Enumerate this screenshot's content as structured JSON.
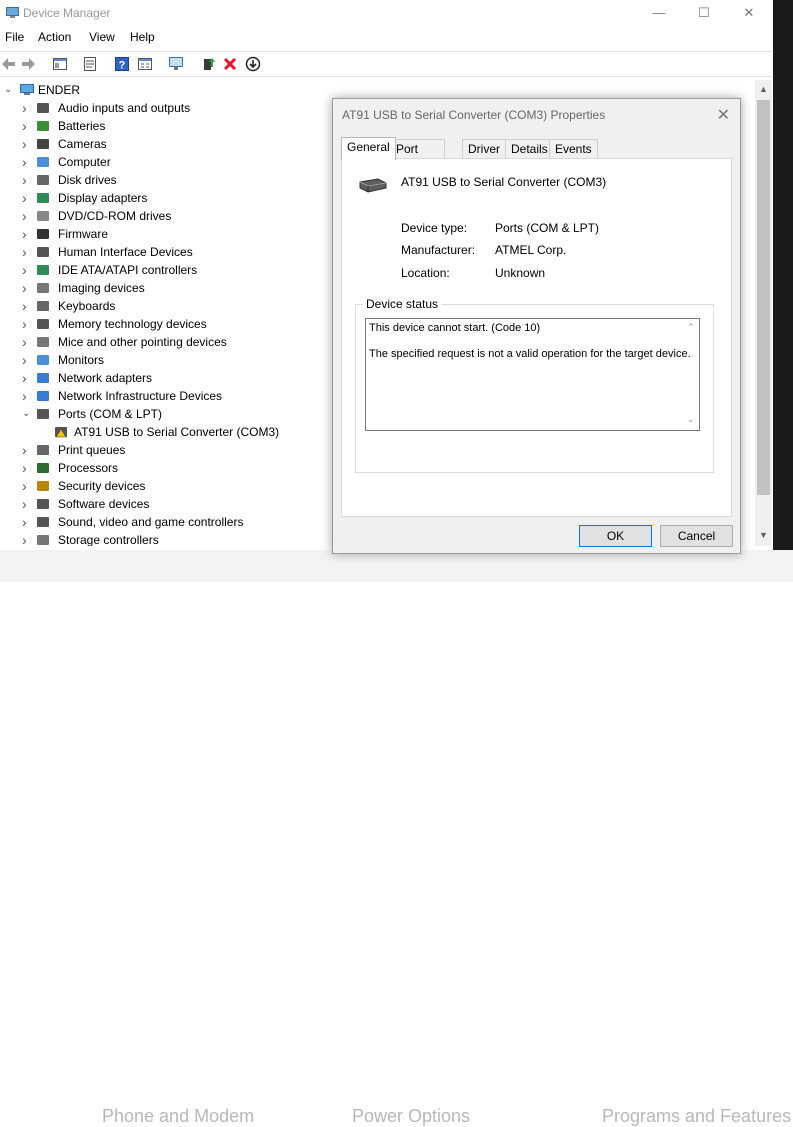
{
  "device_manager": {
    "title": "Device Manager",
    "menu": [
      "File",
      "Action",
      "View",
      "Help"
    ],
    "tree": {
      "root": "ENDER",
      "items": [
        {
          "label": "Audio inputs and outputs",
          "icon": "speaker-icon"
        },
        {
          "label": "Batteries",
          "icon": "battery-icon"
        },
        {
          "label": "Cameras",
          "icon": "camera-icon"
        },
        {
          "label": "Computer",
          "icon": "computer-icon"
        },
        {
          "label": "Disk drives",
          "icon": "disk-icon"
        },
        {
          "label": "Display adapters",
          "icon": "display-adapter-icon"
        },
        {
          "label": "DVD/CD-ROM drives",
          "icon": "dvd-icon"
        },
        {
          "label": "Firmware",
          "icon": "firmware-icon"
        },
        {
          "label": "Human Interface Devices",
          "icon": "hid-icon"
        },
        {
          "label": "IDE ATA/ATAPI controllers",
          "icon": "ide-icon"
        },
        {
          "label": "Imaging devices",
          "icon": "imaging-icon"
        },
        {
          "label": "Keyboards",
          "icon": "keyboard-icon"
        },
        {
          "label": "Memory technology devices",
          "icon": "memory-icon"
        },
        {
          "label": "Mice and other pointing devices",
          "icon": "mouse-icon"
        },
        {
          "label": "Monitors",
          "icon": "monitor-icon"
        },
        {
          "label": "Network adapters",
          "icon": "network-icon"
        },
        {
          "label": "Network Infrastructure Devices",
          "icon": "network-infra-icon"
        },
        {
          "label": "Ports (COM & LPT)",
          "icon": "port-icon",
          "expanded": true
        },
        {
          "label": "AT91 USB to Serial Converter (COM3)",
          "icon": "warning-port-icon",
          "child": true
        },
        {
          "label": "Print queues",
          "icon": "printer-icon"
        },
        {
          "label": "Processors",
          "icon": "processor-icon"
        },
        {
          "label": "Security devices",
          "icon": "security-icon"
        },
        {
          "label": "Software devices",
          "icon": "software-icon"
        },
        {
          "label": "Sound, video and game controllers",
          "icon": "sound-icon"
        },
        {
          "label": "Storage controllers",
          "icon": "storage-icon"
        }
      ]
    }
  },
  "dialog": {
    "title": "AT91 USB to Serial Converter (COM3) Properties",
    "tabs": [
      "General",
      "Port Settings",
      "Driver",
      "Details",
      "Events"
    ],
    "active_tab": "General",
    "device_name": "AT91 USB to Serial Converter (COM3)",
    "properties": {
      "type_label": "Device type:",
      "type_value": "Ports (COM & LPT)",
      "manufacturer_label": "Manufacturer:",
      "manufacturer_value": "ATMEL Corp.",
      "location_label": "Location:",
      "location_value": "Unknown"
    },
    "status_group_title": "Device status",
    "status_line1": "This device cannot start. (Code 10)",
    "status_line2": "The specified request is not a valid operation for the target device.",
    "ok_label": "OK",
    "cancel_label": "Cancel"
  },
  "background": {
    "ghost_text_1": "Phone and Modem",
    "ghost_text_2": "Power Options",
    "ghost_text_3": "Programs and Features"
  },
  "colors": {
    "accent": "#0078d7",
    "error_red": "#e81123",
    "dialog_bg": "#f0f0f0"
  }
}
